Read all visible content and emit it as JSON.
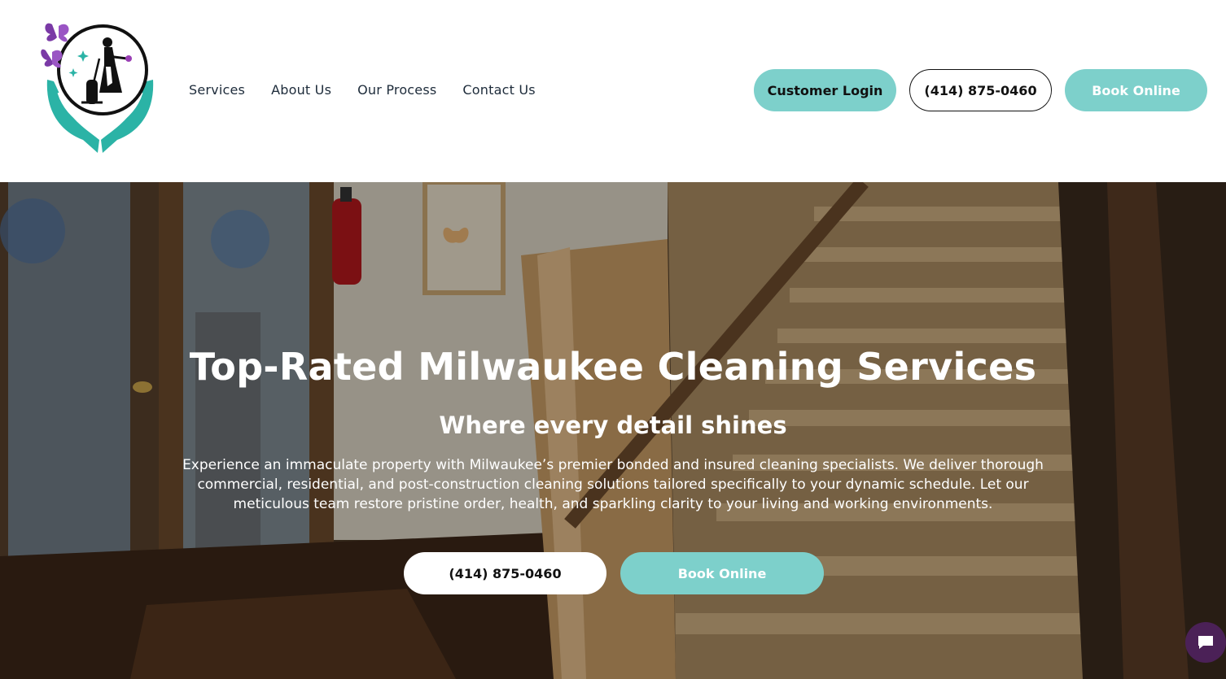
{
  "brand": {
    "logo_icon": "maid-butterfly-hands-logo",
    "accent": "#7dd0cb",
    "purple": "#6b2a8c"
  },
  "nav": {
    "items": [
      {
        "label": "Services"
      },
      {
        "label": "About Us"
      },
      {
        "label": "Our Process"
      },
      {
        "label": "Contact Us"
      }
    ]
  },
  "header_actions": {
    "login_label": "Customer Login",
    "phone_label": "(414) 875-0460",
    "book_label": "Book Online"
  },
  "hero": {
    "title": "Top-Rated Milwaukee Cleaning Services",
    "subtitle": "Where every detail shines",
    "body": "Experience an immaculate property with Milwaukee’s premier bonded and insured cleaning specialists. We deliver thorough commercial, residential, and post-construction cleaning solutions tailored specifically to your dynamic schedule. Let our meticulous team restore pristine order, health, and sparkling clarity to your living and working environments.",
    "phone_label": "(414) 875-0460",
    "book_label": "Book Online",
    "background_icon": "staircase-hallway-photo"
  },
  "chat": {
    "icon": "chat-bubble-icon",
    "color": "#4b2157"
  }
}
